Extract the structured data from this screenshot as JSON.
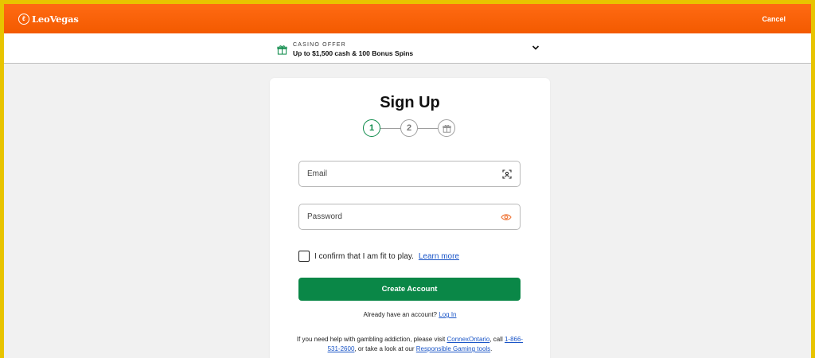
{
  "header": {
    "brand": "LeoVegas",
    "cancel_label": "Cancel"
  },
  "offer": {
    "label": "CASINO OFFER",
    "title": "Up to $1,500 cash & 100 Bonus Spins"
  },
  "signup": {
    "title": "Sign Up",
    "steps": [
      "1",
      "2"
    ],
    "email_placeholder": "Email",
    "password_placeholder": "Password",
    "confirm_text": "I confirm that I am fit to play.",
    "learn_more": "Learn more",
    "create_button": "Create Account",
    "have_account": "Already have an account?",
    "login_link": "Log In",
    "help_part1": "If you need help with gambling addiction, please visit",
    "help_link1": "ConnexOntario",
    "help_part2": ", call",
    "help_phone": "1-866-531-2600",
    "help_part3": ", or take a look at our",
    "help_link2": "Responsible Gaming tools",
    "help_part4": "."
  },
  "colors": {
    "header_orange": "#f35a00",
    "primary_green": "#0a8747",
    "link_blue": "#1a55c7",
    "eye_icon": "#f07a3e"
  }
}
